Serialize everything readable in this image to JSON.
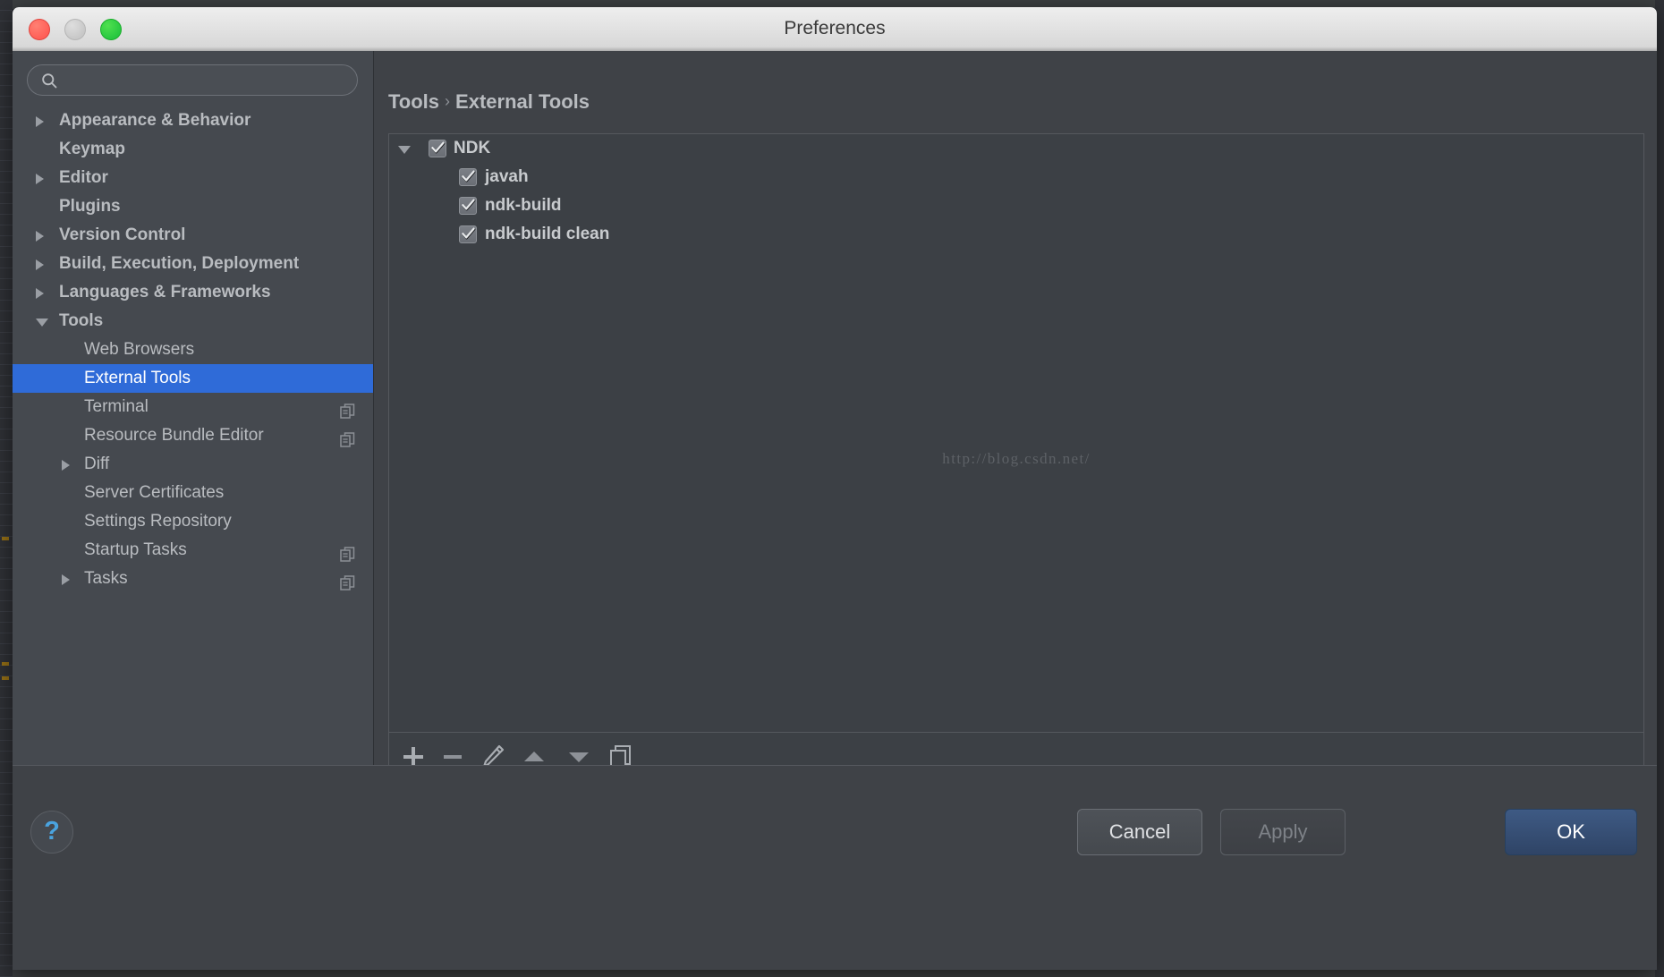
{
  "window": {
    "title": "Preferences",
    "traffic_lights": [
      "close",
      "minimize",
      "maximize"
    ]
  },
  "search": {
    "value": "",
    "placeholder": "",
    "icon": "search-icon"
  },
  "sidebar": {
    "items": [
      {
        "label": "Appearance & Behavior",
        "level": 0,
        "arrow": "right",
        "bold": true,
        "selected": false,
        "copy_icon": false
      },
      {
        "label": "Keymap",
        "level": 0,
        "arrow": "none",
        "bold": true,
        "selected": false,
        "copy_icon": false
      },
      {
        "label": "Editor",
        "level": 0,
        "arrow": "right",
        "bold": true,
        "selected": false,
        "copy_icon": false
      },
      {
        "label": "Plugins",
        "level": 0,
        "arrow": "none",
        "bold": true,
        "selected": false,
        "copy_icon": false
      },
      {
        "label": "Version Control",
        "level": 0,
        "arrow": "right",
        "bold": true,
        "selected": false,
        "copy_icon": false
      },
      {
        "label": "Build, Execution, Deployment",
        "level": 0,
        "arrow": "right",
        "bold": true,
        "selected": false,
        "copy_icon": false
      },
      {
        "label": "Languages & Frameworks",
        "level": 0,
        "arrow": "right",
        "bold": true,
        "selected": false,
        "copy_icon": false
      },
      {
        "label": "Tools",
        "level": 0,
        "arrow": "down",
        "bold": true,
        "selected": false,
        "copy_icon": false
      },
      {
        "label": "Web Browsers",
        "level": 1,
        "arrow": "none",
        "bold": false,
        "selected": false,
        "copy_icon": false
      },
      {
        "label": "External Tools",
        "level": 1,
        "arrow": "none",
        "bold": false,
        "selected": true,
        "copy_icon": false
      },
      {
        "label": "Terminal",
        "level": 1,
        "arrow": "none",
        "bold": false,
        "selected": false,
        "copy_icon": true
      },
      {
        "label": "Resource Bundle Editor",
        "level": 1,
        "arrow": "none",
        "bold": false,
        "selected": false,
        "copy_icon": true
      },
      {
        "label": "Diff",
        "level": 1,
        "arrow": "right",
        "bold": false,
        "selected": false,
        "copy_icon": false
      },
      {
        "label": "Server Certificates",
        "level": 1,
        "arrow": "none",
        "bold": false,
        "selected": false,
        "copy_icon": false
      },
      {
        "label": "Settings Repository",
        "level": 1,
        "arrow": "none",
        "bold": false,
        "selected": false,
        "copy_icon": false
      },
      {
        "label": "Startup Tasks",
        "level": 1,
        "arrow": "none",
        "bold": false,
        "selected": false,
        "copy_icon": true
      },
      {
        "label": "Tasks",
        "level": 1,
        "arrow": "right",
        "bold": false,
        "selected": false,
        "copy_icon": true
      }
    ]
  },
  "panel": {
    "breadcrumb": {
      "parent": "Tools",
      "separator": "›",
      "current": "External Tools"
    },
    "tree": [
      {
        "label": "NDK",
        "level": 0,
        "checked": true,
        "expanded": true
      },
      {
        "label": "javah",
        "level": 1,
        "checked": true,
        "expanded": false
      },
      {
        "label": "ndk-build",
        "level": 1,
        "checked": true,
        "expanded": false
      },
      {
        "label": "ndk-build clean",
        "level": 1,
        "checked": true,
        "expanded": false
      }
    ],
    "watermark": "http://blog.csdn.net/",
    "toolbar": [
      {
        "name": "add-button",
        "glyph": "plus-icon"
      },
      {
        "name": "remove-button",
        "glyph": "minus-icon"
      },
      {
        "name": "edit-button",
        "glyph": "pencil-icon"
      },
      {
        "name": "move-up-button",
        "glyph": "triangle-up-icon"
      },
      {
        "name": "move-down-button",
        "glyph": "triangle-down-icon"
      },
      {
        "name": "copy-button",
        "glyph": "copy-icon"
      }
    ]
  },
  "footer": {
    "help_label": "?",
    "cancel_label": "Cancel",
    "apply_label": "Apply",
    "ok_label": "OK"
  },
  "colors": {
    "accent_selection": "#2f6bd8",
    "ok_button": "#3e5a84",
    "window_bg": "#3f4247",
    "sidebar_bg": "#45494f",
    "panel_bg": "#3c4045",
    "help_blue": "#4aa3df"
  }
}
